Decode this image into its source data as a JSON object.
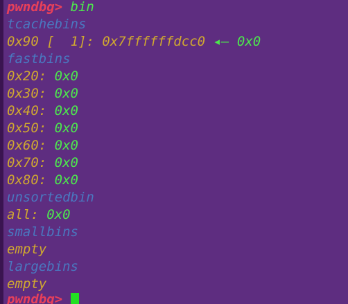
{
  "prompt": "pwndbg>",
  "command": "bin",
  "tcache": {
    "header": "tcachebins",
    "size": "0x90",
    "bracket_open": "[",
    "count": "1",
    "bracket_close": "]:",
    "address": "0x7ffffffdcc0",
    "arrow": "◂—",
    "next": "0x0"
  },
  "fastbins": {
    "header": "fastbins",
    "entries": [
      {
        "size": "0x20:",
        "value": "0x0"
      },
      {
        "size": "0x30:",
        "value": "0x0"
      },
      {
        "size": "0x40:",
        "value": "0x0"
      },
      {
        "size": "0x50:",
        "value": "0x0"
      },
      {
        "size": "0x60:",
        "value": "0x0"
      },
      {
        "size": "0x70:",
        "value": "0x0"
      },
      {
        "size": "0x80:",
        "value": "0x0"
      }
    ]
  },
  "unsortedbin": {
    "header": "unsortedbin",
    "label": "all:",
    "value": "0x0"
  },
  "smallbins": {
    "header": "smallbins",
    "value": "empty"
  },
  "largebins": {
    "header": "largebins",
    "value": "empty"
  },
  "colors": {
    "background": "#5e2d80",
    "prompt": "#e8405a",
    "command": "#4de84d",
    "header": "#4a78c0",
    "label": "#d0a830",
    "value": "#4de84d",
    "cursor": "#22e022"
  }
}
